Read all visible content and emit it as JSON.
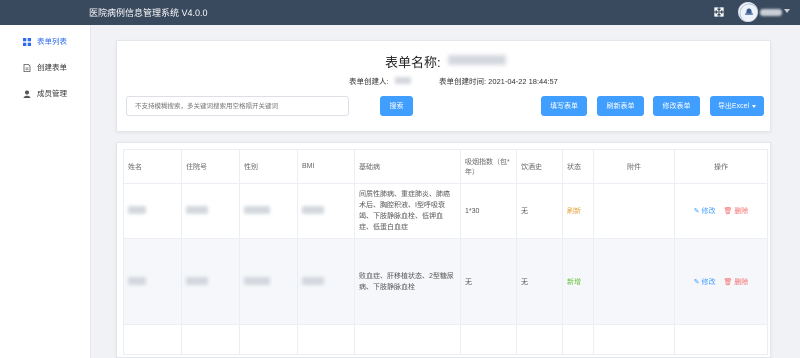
{
  "app": {
    "title": "医院病例信息管理系统   V4.0.0"
  },
  "sidebar": {
    "items": [
      {
        "label": "表单列表",
        "icon": "grid-icon"
      },
      {
        "label": "创建表单",
        "icon": "document-icon"
      },
      {
        "label": "成员管理",
        "icon": "user-icon"
      }
    ]
  },
  "form": {
    "title_label": "表单名称:",
    "creator_label": "表单创建人:",
    "created_time": "表单创建时间:  2021-04-22 18:44:57",
    "search_placeholder": "不支持模糊搜索，多关键词搜索用空格隔开关键词",
    "buttons": {
      "search": "搜索",
      "fill": "填写表单",
      "refresh": "刷新表单",
      "edit": "修改表单",
      "export": "导出Excel"
    }
  },
  "table": {
    "headers": [
      "姓名",
      "住院号",
      "性别",
      "BMI",
      "基础病",
      "吸烟指数（包*年）",
      "饮酒史",
      "状态",
      "附件",
      "操作"
    ],
    "rows": [
      {
        "disease": "间质性肺病、重症肺炎、肺癌术后、胸腔积液、I型呼吸衰竭、下肢静脉血栓、低钾血症、低蛋白血症",
        "smoking": "1*30",
        "alcohol": "无",
        "status": "刷新",
        "edit": "修改",
        "delete": "删除"
      },
      {
        "disease": "败血症、肝移植状态、2型糖尿病、下肢静脉血栓",
        "smoking": "无",
        "alcohol": "无",
        "status": "新增",
        "edit": "修改",
        "delete": "删除"
      }
    ]
  },
  "colors": {
    "topbar": "#3a4a5e",
    "primary": "#409eff",
    "refresh": "#e6a23c",
    "new": "#67c23a",
    "danger": "#f56c6c"
  }
}
